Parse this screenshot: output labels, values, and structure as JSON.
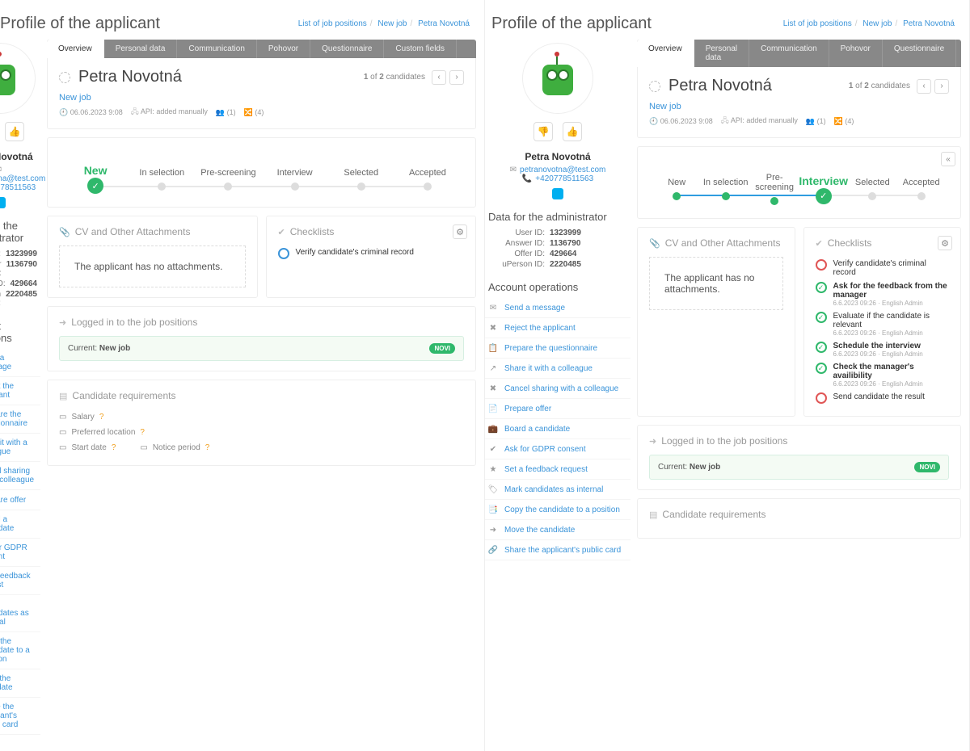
{
  "page_title": "Profile of the applicant",
  "breadcrumbs": [
    {
      "label": "List of job positions",
      "link": true
    },
    {
      "label": "New job",
      "link": true
    },
    {
      "label": "Petra Novotná",
      "link": true,
      "active": true
    }
  ],
  "applicant": {
    "name": "Petra Novotná",
    "email": "petranovotna@test.com",
    "phone": "+420778511563"
  },
  "admin_data_title": "Data for the administrator",
  "admin_data": [
    {
      "k": "User ID:",
      "v": "1323999"
    },
    {
      "k": "Answer ID:",
      "v": "1136790"
    },
    {
      "k": "Offer ID:",
      "v": "429664"
    },
    {
      "k": "uPerson ID:",
      "v": "2220485"
    }
  ],
  "account_ops_title": "Account operations",
  "account_ops": [
    {
      "icon": "✉",
      "label": "Send a message"
    },
    {
      "icon": "✖",
      "label": "Reject the applicant"
    },
    {
      "icon": "📋",
      "label": "Prepare the questionnaire"
    },
    {
      "icon": "↗",
      "label": "Share it with a colleague"
    },
    {
      "icon": "✖",
      "label": "Cancel sharing with a colleague"
    },
    {
      "icon": "📄",
      "label": "Prepare offer"
    },
    {
      "icon": "💼",
      "label": "Board a candidate"
    },
    {
      "icon": "✔",
      "label": "Ask for GDPR consent"
    },
    {
      "icon": "★",
      "label": "Set a feedback request"
    },
    {
      "icon": "🏷",
      "label": "Mark candidates as internal"
    },
    {
      "icon": "📑",
      "label": "Copy the candidate to a position"
    },
    {
      "icon": "➜",
      "label": "Move the candidate"
    },
    {
      "icon": "🔗",
      "label": "Share the applicant's public card"
    }
  ],
  "tabs": [
    "Overview",
    "Personal data",
    "Communication",
    "Pohovor",
    "Questionnaire",
    "Custom fields"
  ],
  "active_tab": 0,
  "candidate_counter": {
    "pre": "1",
    "mid": " of ",
    "total": "2",
    "post": " candidates"
  },
  "job_link": "New job",
  "meta": {
    "date": "06.06.2023 9:08",
    "source": "API: added manually",
    "people": "(1)",
    "flows": "(4)"
  },
  "stages": [
    "New",
    "In selection",
    "Pre-screening",
    "Interview",
    "Selected",
    "Accepted"
  ],
  "panes": [
    {
      "active_stage": 0,
      "progress_pct": 0
    },
    {
      "active_stage": 3,
      "progress_pct": 58
    }
  ],
  "sections": {
    "attachments_title": "CV and Other Attachments",
    "no_attachments": "The applicant has no attachments.",
    "checklists_title": "Checklists",
    "logged_title": "Logged in to the job positions",
    "requirements_title": "Candidate requirements"
  },
  "checklists": {
    "simple": [
      {
        "state": "blue",
        "label": "Verify candidate's criminal record"
      }
    ],
    "full": [
      {
        "state": "red",
        "label": "Verify candidate's criminal record"
      },
      {
        "state": "green",
        "label": "Ask for the feedback from the manager",
        "meta": "6.6.2023 09:26 · English Admin"
      },
      {
        "state": "green",
        "label": "Evaluate if the candidate is relevant",
        "meta": "6.6.2023 09:26 · English Admin"
      },
      {
        "state": "green",
        "label": "Schedule the interview",
        "meta": "6.6.2023 09:26 · English Admin"
      },
      {
        "state": "green",
        "label": "Check the manager's availibility",
        "meta": "6.6.2023 09:26 · English Admin"
      },
      {
        "state": "red",
        "label": "Send candidate the result"
      }
    ]
  },
  "current_job": {
    "pre": "Current: ",
    "name": "New job",
    "badge": "NOVI"
  },
  "requirements": [
    {
      "label": "Salary"
    },
    {
      "label": "Preferred location"
    },
    {
      "label": "Start date"
    },
    {
      "label": "Notice period"
    }
  ]
}
